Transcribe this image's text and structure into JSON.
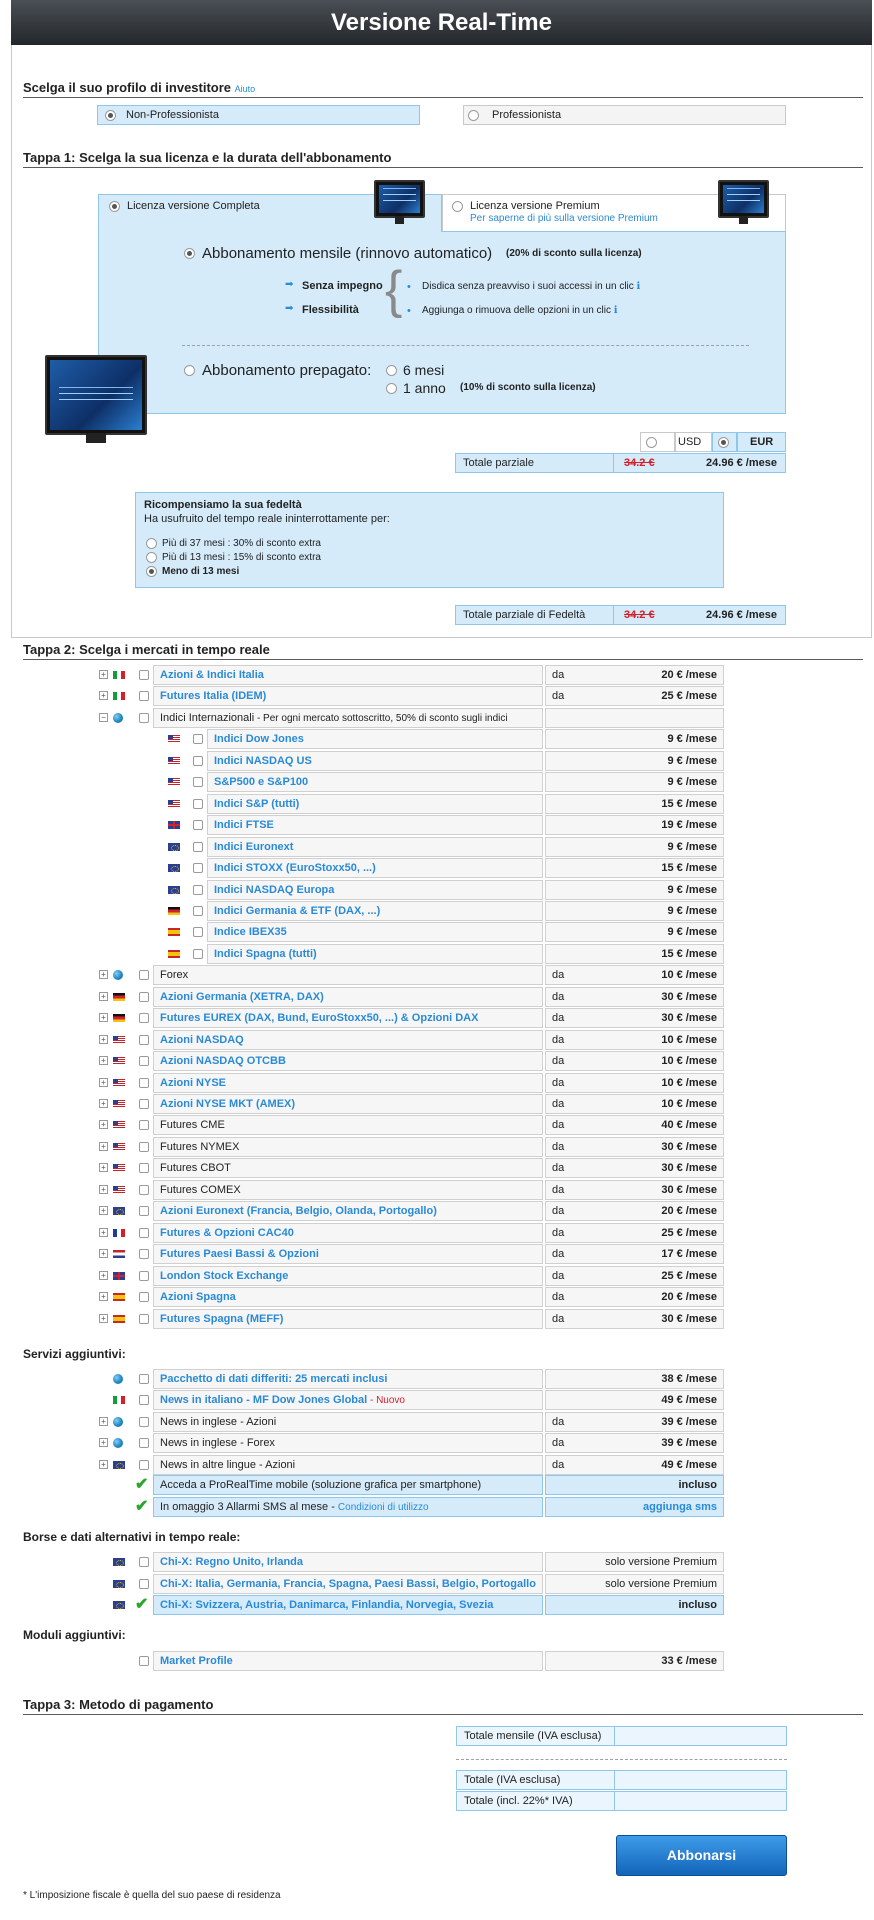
{
  "title": "Versione Real-Time",
  "profile": {
    "heading": "Scelga il suo profilo di investitore",
    "help": "Aiuto",
    "opt1": "Non-Professionista",
    "opt2": "Professionista"
  },
  "step1": {
    "heading": "Tappa 1: Scelga la sua licenza e la durata dell'abbonamento",
    "tab_full": "Licenza versione Completa",
    "tab_premium": "Licenza versione Premium",
    "tab_premium_link": "Per saperne di più sulla versione Premium",
    "monthly": "Abbonamento mensile (rinnovo automatico)",
    "monthly_discount": "(20% di sconto sulla licenza)",
    "no_commit": "Senza impegno",
    "flex": "Flessibilità",
    "no_commit_desc": "Disdica senza preavviso i suoi accessi in un clic",
    "flex_desc": "Aggiunga o rimuova delle opzioni in un clic",
    "prepaid": "Abbonamento prepagato:",
    "six": "6 mesi",
    "year": "1 anno",
    "year_discount": "(10% di sconto sulla licenza)",
    "usd": "USD",
    "eur": "EUR",
    "subtotal": "Totale parziale",
    "old_price": "34.2 €",
    "new_price": "24.96 € /mese",
    "loyalty_title": "Ricompensiamo la sua fedeltà",
    "loyalty_desc": "Ha usufruito del tempo reale ininterrottamente per:",
    "l1": "Più di 37 mesi : 30% di sconto extra",
    "l2": "Più di 13 mesi : 15% di sconto extra",
    "l3": "Meno di 13 mesi",
    "loyalty_subtotal": "Totale parziale di Fedeltà"
  },
  "step2": {
    "heading": "Tappa 2: Scelga i mercati in tempo reale",
    "markets": [
      {
        "exp": "+",
        "flag": "it",
        "name": "Azioni & Indici Italia",
        "link": true,
        "da": "da",
        "price": "20 € /mese"
      },
      {
        "exp": "+",
        "flag": "it",
        "name": "Futures Italia (IDEM)",
        "link": true,
        "da": "da",
        "price": "25 € /mese"
      },
      {
        "exp": "−",
        "flag": "globe",
        "name": "Indici Internazionali",
        "note": " - Per ogni mercato sottoscritto, 50% di sconto sugli indici",
        "link": false,
        "da": "",
        "price": ""
      },
      {
        "sub": true,
        "flag": "us",
        "name": "Indici Dow Jones",
        "link": true,
        "da": "",
        "price": "9 € /mese"
      },
      {
        "sub": true,
        "flag": "us",
        "name": "Indici NASDAQ US",
        "link": true,
        "da": "",
        "price": "9 € /mese"
      },
      {
        "sub": true,
        "flag": "us",
        "name": "S&P500 e S&P100",
        "link": true,
        "da": "",
        "price": "9 € /mese"
      },
      {
        "sub": true,
        "flag": "us",
        "name": "Indici S&P (tutti)",
        "link": true,
        "da": "",
        "price": "15 € /mese"
      },
      {
        "sub": true,
        "flag": "gb",
        "name": "Indici FTSE",
        "link": true,
        "da": "",
        "price": "19 € /mese"
      },
      {
        "sub": true,
        "flag": "eu",
        "name": "Indici Euronext",
        "link": true,
        "da": "",
        "price": "9 € /mese"
      },
      {
        "sub": true,
        "flag": "eu",
        "name": "Indici STOXX (EuroStoxx50, ...)",
        "link": true,
        "da": "",
        "price": "15 € /mese"
      },
      {
        "sub": true,
        "flag": "eu",
        "name": "Indici NASDAQ Europa",
        "link": true,
        "da": "",
        "price": "9 € /mese"
      },
      {
        "sub": true,
        "flag": "de",
        "name": "Indici Germania & ETF (DAX, ...)",
        "link": true,
        "da": "",
        "price": "9 € /mese"
      },
      {
        "sub": true,
        "flag": "es",
        "name": "Indice IBEX35",
        "link": true,
        "da": "",
        "price": "9 € /mese"
      },
      {
        "sub": true,
        "flag": "es",
        "name": "Indici Spagna (tutti)",
        "link": true,
        "da": "",
        "price": "15 € /mese"
      },
      {
        "exp": "+",
        "flag": "globe",
        "name": "Forex",
        "link": false,
        "da": "da",
        "price": "10 € /mese"
      },
      {
        "exp": "+",
        "flag": "de",
        "name": "Azioni Germania (XETRA, DAX)",
        "link": true,
        "da": "da",
        "price": "30 € /mese"
      },
      {
        "exp": "+",
        "flag": "de",
        "name": "Futures EUREX (DAX, Bund, EuroStoxx50, ...) & Opzioni DAX",
        "link": true,
        "da": "da",
        "price": "30 € /mese"
      },
      {
        "exp": "+",
        "flag": "us",
        "name": "Azioni NASDAQ",
        "link": true,
        "da": "da",
        "price": "10 € /mese"
      },
      {
        "exp": "+",
        "flag": "us",
        "name": "Azioni NASDAQ OTCBB",
        "link": true,
        "da": "da",
        "price": "10 € /mese"
      },
      {
        "exp": "+",
        "flag": "us",
        "name": "Azioni NYSE",
        "link": true,
        "da": "da",
        "price": "10 € /mese"
      },
      {
        "exp": "+",
        "flag": "us",
        "name": "Azioni NYSE MKT (AMEX)",
        "link": true,
        "da": "da",
        "price": "10 € /mese"
      },
      {
        "exp": "+",
        "flag": "us",
        "name": "Futures CME",
        "link": false,
        "da": "da",
        "price": "40 € /mese"
      },
      {
        "exp": "+",
        "flag": "us",
        "name": "Futures NYMEX",
        "link": false,
        "da": "da",
        "price": "30 € /mese"
      },
      {
        "exp": "+",
        "flag": "us",
        "name": "Futures CBOT",
        "link": false,
        "da": "da",
        "price": "30 € /mese"
      },
      {
        "exp": "+",
        "flag": "us",
        "name": "Futures COMEX",
        "link": false,
        "da": "da",
        "price": "30 € /mese"
      },
      {
        "exp": "+",
        "flag": "eu",
        "name": "Azioni Euronext (Francia, Belgio, Olanda, Portogallo)",
        "link": true,
        "da": "da",
        "price": "20 € /mese"
      },
      {
        "exp": "+",
        "flag": "fr",
        "name": "Futures & Opzioni CAC40",
        "link": true,
        "da": "da",
        "price": "25 € /mese"
      },
      {
        "exp": "+",
        "flag": "nl",
        "name": "Futures Paesi Bassi & Opzioni",
        "link": true,
        "da": "da",
        "price": "17 € /mese"
      },
      {
        "exp": "+",
        "flag": "gb",
        "name": "London Stock Exchange",
        "link": true,
        "da": "da",
        "price": "25 € /mese"
      },
      {
        "exp": "+",
        "flag": "es",
        "name": "Azioni Spagna",
        "link": true,
        "da": "da",
        "price": "20 € /mese"
      },
      {
        "exp": "+",
        "flag": "es",
        "name": "Futures Spagna (MEFF)",
        "link": true,
        "da": "da",
        "price": "30 € /mese"
      }
    ]
  },
  "services": {
    "heading": "Servizi aggiuntivi:",
    "items": [
      {
        "exp": "",
        "flag": "globe",
        "name": "Pacchetto di dati differiti: 25 mercati inclusi",
        "link": true,
        "da": "",
        "price": "38 € /mese"
      },
      {
        "exp": "",
        "flag": "it",
        "name": "News in italiano - MF Dow Jones Global",
        "new": " - Nuovo",
        "link": true,
        "da": "",
        "price": "49 € /mese"
      },
      {
        "exp": "+",
        "flag": "globe",
        "name": "News in inglese - Azioni",
        "link": false,
        "da": "da",
        "price": "39 € /mese"
      },
      {
        "exp": "+",
        "flag": "globe",
        "name": "News in inglese - Forex",
        "link": false,
        "da": "da",
        "price": "39 € /mese"
      },
      {
        "exp": "+",
        "flag": "eu",
        "name": "News in altre lingue - Azioni",
        "link": false,
        "da": "da",
        "price": "49 € /mese"
      }
    ],
    "mobile": "Acceda a ProRealTime mobile (soluzione grafica per smartphone)",
    "mobile_status": "incluso",
    "sms": "In omaggio 3 Allarmi SMS al mese",
    "sms_link": "Condizioni di utilizzo",
    "sms_action": "aggiunga sms"
  },
  "alt": {
    "heading": "Borse e dati alternativi in tempo reale:",
    "items": [
      {
        "name": "Chi-X: Regno Unito, Irlanda",
        "status": "solo versione Premium"
      },
      {
        "name": "Chi-X: Italia, Germania, Francia, Spagna, Paesi Bassi, Belgio, Portogallo",
        "status": "solo versione Premium"
      },
      {
        "name": "Chi-X: Svizzera, Austria, Danimarca, Finlandia, Norvegia, Svezia",
        "status": "incluso"
      }
    ]
  },
  "modules": {
    "heading": "Moduli aggiuntivi:",
    "name": "Market Profile",
    "price": "33 € /mese"
  },
  "step3": {
    "heading": "Tappa 3: Metodo di pagamento",
    "monthly_total": "Totale mensile (IVA esclusa)",
    "total": "Totale (IVA esclusa)",
    "total_vat": "Totale (incl. 22%* IVA)",
    "subscribe": "Abbonarsi",
    "footnote": "* L'imposizione fiscale è quella del suo paese di residenza"
  }
}
